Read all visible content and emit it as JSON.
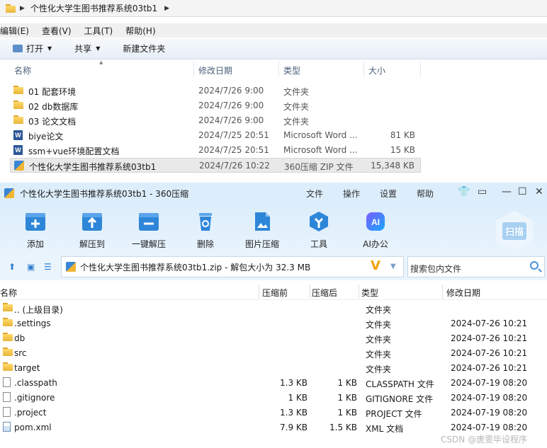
{
  "explorer": {
    "breadcrumb": "个性化大学生图书推荐系统03tb1",
    "menu": [
      "编辑(E)",
      "查看(V)",
      "工具(T)",
      "帮助(H)"
    ],
    "toolbar": {
      "open": "打开",
      "share": "共享",
      "new_folder": "新建文件夹"
    },
    "columns": {
      "name": "名称",
      "date": "修改日期",
      "type": "类型",
      "size": "大小"
    },
    "rows": [
      {
        "name": "01 配套环境",
        "date": "2024/7/26 9:00",
        "type": "文件夹",
        "size": "",
        "icon": "folder-icon"
      },
      {
        "name": "02 db数据库",
        "date": "2024/7/26 9:00",
        "type": "文件夹",
        "size": "",
        "icon": "folder-icon"
      },
      {
        "name": "03 论文文档",
        "date": "2024/7/26 9:00",
        "type": "文件夹",
        "size": "",
        "icon": "folder-icon"
      },
      {
        "name": "biye论文",
        "date": "2024/7/25 20:51",
        "type": "Microsoft Word ...",
        "size": "81 KB",
        "icon": "word-icon"
      },
      {
        "name": "ssm+vue环境配置文档",
        "date": "2024/7/25 20:51",
        "type": "Microsoft Word ...",
        "size": "15 KB",
        "icon": "word-icon"
      },
      {
        "name": "个性化大学生图书推荐系统03tb1",
        "date": "2024/7/26 10:22",
        "type": "360压缩 ZIP 文件",
        "size": "15,348 KB",
        "icon": "zip-icon"
      }
    ]
  },
  "zip_window": {
    "title": "个性化大学生图书推荐系统03tb1 - 360压缩",
    "menu": [
      "文件",
      "操作",
      "设置",
      "帮助"
    ],
    "tools": [
      {
        "label": "添加",
        "icon": "add-icon"
      },
      {
        "label": "解压到",
        "icon": "extract-to-icon"
      },
      {
        "label": "一键解压",
        "icon": "one-click-extract-icon"
      },
      {
        "label": "删除",
        "icon": "delete-icon"
      },
      {
        "label": "图片压缩",
        "icon": "image-compress-icon"
      },
      {
        "label": "工具",
        "icon": "tools-icon"
      },
      {
        "label": "AI办公",
        "icon": "ai-office-icon"
      }
    ],
    "scan_label": "扫描",
    "path_text": "个性化大学生图书推荐系统03tb1.zip - 解包大小为 32.3 MB",
    "search_placeholder": "搜索包内文件",
    "columns": {
      "name": "名称",
      "compressed": "压缩前",
      "original": "压缩后",
      "type": "类型",
      "modified": "修改日期"
    },
    "rows": [
      {
        "name": ".. (上级目录)",
        "comp": "",
        "orig": "",
        "type": "文件夹",
        "mod": "",
        "icon": "folder-icon"
      },
      {
        "name": ".settings",
        "comp": "",
        "orig": "",
        "type": "文件夹",
        "mod": "2024-07-26 10:21",
        "icon": "folder-icon"
      },
      {
        "name": "db",
        "comp": "",
        "orig": "",
        "type": "文件夹",
        "mod": "2024-07-26 10:21",
        "icon": "folder-icon"
      },
      {
        "name": "src",
        "comp": "",
        "orig": "",
        "type": "文件夹",
        "mod": "2024-07-26 10:21",
        "icon": "folder-icon"
      },
      {
        "name": "target",
        "comp": "",
        "orig": "",
        "type": "文件夹",
        "mod": "2024-07-26 10:21",
        "icon": "folder-icon"
      },
      {
        "name": ".classpath",
        "comp": "1.3 KB",
        "orig": "1 KB",
        "type": "CLASSPATH 文件",
        "mod": "2024-07-19 08:20",
        "icon": "file-icon"
      },
      {
        "name": ".gitignore",
        "comp": "1 KB",
        "orig": "1 KB",
        "type": "GITIGNORE 文件",
        "mod": "2024-07-19 08:20",
        "icon": "file-icon"
      },
      {
        "name": ".project",
        "comp": "1.3 KB",
        "orig": "1 KB",
        "type": "PROJECT 文件",
        "mod": "2024-07-19 08:20",
        "icon": "file-icon"
      },
      {
        "name": "pom.xml",
        "comp": "7.9 KB",
        "orig": "1.5 KB",
        "type": "XML 文档",
        "mod": "2024-07-19 08:20",
        "icon": "xml-file-icon"
      }
    ]
  },
  "watermark": "CSDN @唐雯毕设程序"
}
